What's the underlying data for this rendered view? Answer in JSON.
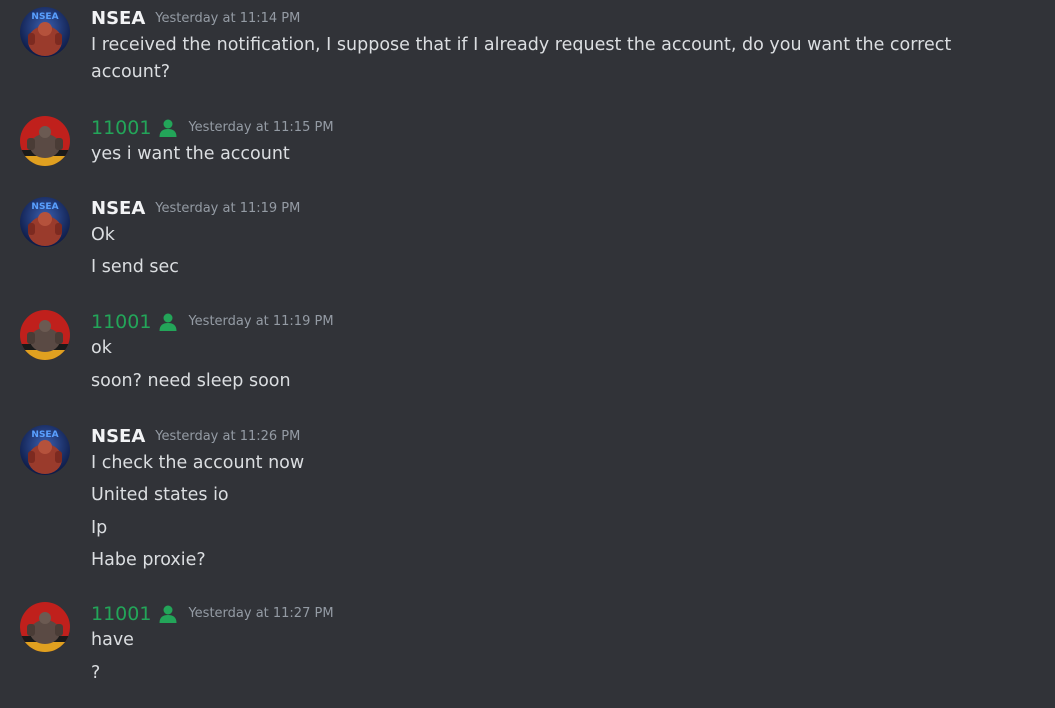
{
  "colors": {
    "background": "#313338",
    "text": "#dbdee1",
    "nsea_name": "#f2f3f5",
    "user_11001_name": "#23a559",
    "timestamp": "#949ba4"
  },
  "messages": [
    {
      "author": "NSEA",
      "timestamp": "Yesterday at 11:14 PM",
      "lines": [
        "I received the notification, I suppose that if I already request the account, do you want the correct",
        "account?"
      ]
    },
    {
      "author": "11001",
      "role_icon": "member-icon",
      "timestamp": "Yesterday at 11:15 PM",
      "lines": [
        "yes i want the account"
      ]
    },
    {
      "author": "NSEA",
      "timestamp": "Yesterday at 11:19 PM",
      "lines": [
        "Ok",
        "I send sec"
      ]
    },
    {
      "author": "11001",
      "role_icon": "member-icon",
      "timestamp": "Yesterday at 11:19 PM",
      "lines": [
        "ok",
        "soon? need sleep soon"
      ]
    },
    {
      "author": "NSEA",
      "timestamp": "Yesterday at 11:26 PM",
      "lines": [
        "I check the account now",
        "United states io",
        "Ip",
        "Habe proxie?"
      ]
    },
    {
      "author": "11001",
      "role_icon": "member-icon",
      "timestamp": "Yesterday at 11:27 PM",
      "lines": [
        "have",
        "?"
      ]
    }
  ]
}
